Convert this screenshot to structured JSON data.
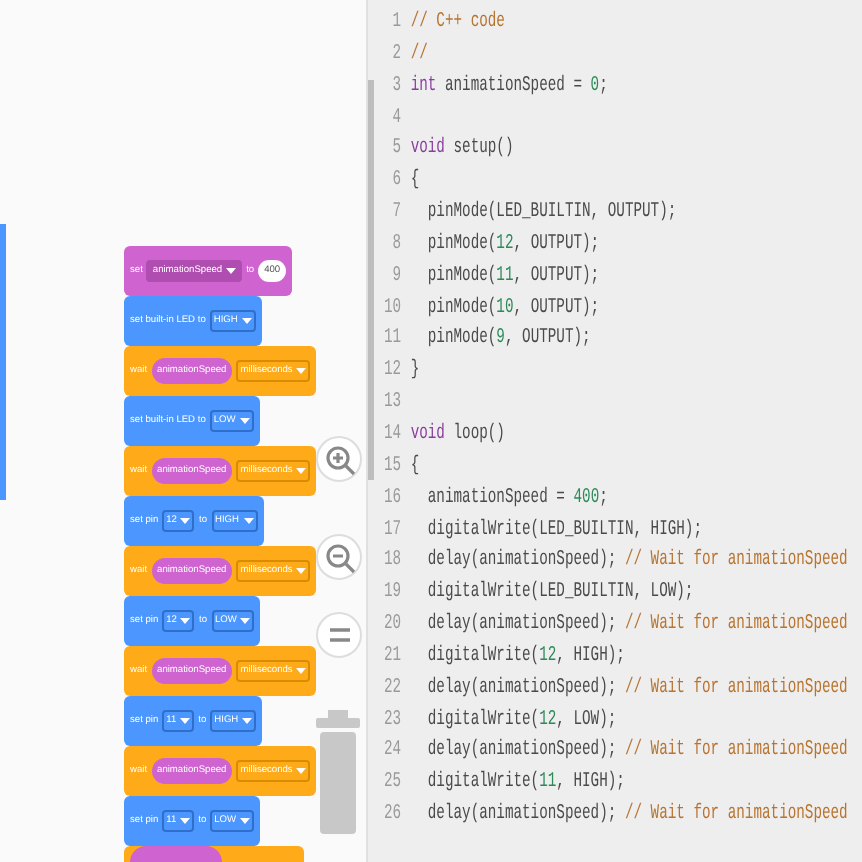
{
  "blocks_workspace": {
    "blocks": [
      {
        "kind": "set_variable",
        "label": "set",
        "variable": "animationSpeed",
        "to": "to",
        "value": "400"
      },
      {
        "kind": "set_led",
        "label": "set built-in LED to",
        "state": "HIGH"
      },
      {
        "kind": "wait",
        "label": "wait",
        "variable": "animationSpeed",
        "unit": "milliseconds"
      },
      {
        "kind": "set_led",
        "label": "set built-in LED to",
        "state": "LOW"
      },
      {
        "kind": "wait",
        "label": "wait",
        "variable": "animationSpeed",
        "unit": "milliseconds"
      },
      {
        "kind": "set_pin",
        "label": "set pin",
        "pin": "12",
        "to": "to",
        "state": "HIGH"
      },
      {
        "kind": "wait",
        "label": "wait",
        "variable": "animationSpeed",
        "unit": "milliseconds"
      },
      {
        "kind": "set_pin",
        "label": "set pin",
        "pin": "12",
        "to": "to",
        "state": "LOW"
      },
      {
        "kind": "wait",
        "label": "wait",
        "variable": "animationSpeed",
        "unit": "milliseconds"
      },
      {
        "kind": "set_pin",
        "label": "set pin",
        "pin": "11",
        "to": "to",
        "state": "HIGH"
      },
      {
        "kind": "wait",
        "label": "wait",
        "variable": "animationSpeed",
        "unit": "milliseconds"
      },
      {
        "kind": "set_pin",
        "label": "set pin",
        "pin": "11",
        "to": "to",
        "state": "LOW"
      },
      {
        "kind": "partial"
      }
    ]
  },
  "code_editor": {
    "lines": [
      {
        "number": "1",
        "tokens": [
          {
            "kind": "comment",
            "text": "// C++ code"
          }
        ]
      },
      {
        "number": "2",
        "tokens": [
          {
            "kind": "comment",
            "text": "//"
          }
        ]
      },
      {
        "number": "3",
        "tokens": [
          {
            "kind": "keyword",
            "text": "int"
          },
          {
            "kind": "plain",
            "text": " animationSpeed = "
          },
          {
            "kind": "number",
            "text": "0"
          },
          {
            "kind": "plain",
            "text": ";"
          }
        ]
      },
      {
        "number": "4"
      },
      {
        "number": "5",
        "tokens": [
          {
            "kind": "keyword",
            "text": "void"
          },
          {
            "kind": "plain",
            "text": " setup()"
          }
        ]
      },
      {
        "number": "6",
        "tokens": [
          {
            "kind": "plain",
            "text": "{"
          }
        ]
      },
      {
        "number": "7",
        "tokens": [
          {
            "kind": "plain",
            "text": "  pinMode(LED_BUILTIN, OUTPUT);"
          }
        ]
      },
      {
        "number": "8",
        "tokens": [
          {
            "kind": "plain",
            "text": "  pinMode("
          },
          {
            "kind": "number",
            "text": "12"
          },
          {
            "kind": "plain",
            "text": ", OUTPUT);"
          }
        ]
      },
      {
        "number": "9",
        "tokens": [
          {
            "kind": "plain",
            "text": "  pinMode("
          },
          {
            "kind": "number",
            "text": "11"
          },
          {
            "kind": "plain",
            "text": ", OUTPUT);"
          }
        ]
      },
      {
        "number": "10",
        "tokens": [
          {
            "kind": "plain",
            "text": "  pinMode("
          },
          {
            "kind": "number",
            "text": "10"
          },
          {
            "kind": "plain",
            "text": ", OUTPUT);"
          }
        ]
      },
      {
        "number": "11",
        "tokens": [
          {
            "kind": "plain",
            "text": "  pinMode("
          },
          {
            "kind": "number",
            "text": "9"
          },
          {
            "kind": "plain",
            "text": ", OUTPUT);"
          }
        ]
      },
      {
        "number": "12",
        "tokens": [
          {
            "kind": "plain",
            "text": "}"
          }
        ]
      },
      {
        "number": "13"
      },
      {
        "number": "14",
        "tokens": [
          {
            "kind": "keyword",
            "text": "void"
          },
          {
            "kind": "plain",
            "text": " loop()"
          }
        ]
      },
      {
        "number": "15",
        "tokens": [
          {
            "kind": "plain",
            "text": "{"
          }
        ]
      },
      {
        "number": "16",
        "tokens": [
          {
            "kind": "plain",
            "text": "  animationSpeed = "
          },
          {
            "kind": "number",
            "text": "400"
          },
          {
            "kind": "plain",
            "text": ";"
          }
        ]
      },
      {
        "number": "17",
        "tokens": [
          {
            "kind": "plain",
            "text": "  digitalWrite(LED_BUILTIN, HIGH);"
          }
        ]
      },
      {
        "number": "18",
        "tokens": [
          {
            "kind": "plain",
            "text": "  delay(animationSpeed); "
          },
          {
            "kind": "comment",
            "text": "// Wait for animationSpeed"
          }
        ]
      },
      {
        "number": "19",
        "tokens": [
          {
            "kind": "plain",
            "text": "  digitalWrite(LED_BUILTIN, LOW);"
          }
        ]
      },
      {
        "number": "20",
        "tokens": [
          {
            "kind": "plain",
            "text": "  delay(animationSpeed); "
          },
          {
            "kind": "comment",
            "text": "// Wait for animationSpeed"
          }
        ]
      },
      {
        "number": "21",
        "tokens": [
          {
            "kind": "plain",
            "text": "  digitalWrite("
          },
          {
            "kind": "number",
            "text": "12"
          },
          {
            "kind": "plain",
            "text": ", HIGH);"
          }
        ]
      },
      {
        "number": "22",
        "tokens": [
          {
            "kind": "plain",
            "text": "  delay(animationSpeed); "
          },
          {
            "kind": "comment",
            "text": "// Wait for animationSpeed"
          }
        ]
      },
      {
        "number": "23",
        "tokens": [
          {
            "kind": "plain",
            "text": "  digitalWrite("
          },
          {
            "kind": "number",
            "text": "12"
          },
          {
            "kind": "plain",
            "text": ", LOW);"
          }
        ]
      },
      {
        "number": "24",
        "tokens": [
          {
            "kind": "plain",
            "text": "  delay(animationSpeed); "
          },
          {
            "kind": "comment",
            "text": "// Wait for animationSpeed"
          }
        ]
      },
      {
        "number": "25",
        "tokens": [
          {
            "kind": "plain",
            "text": "  digitalWrite("
          },
          {
            "kind": "number",
            "text": "11"
          },
          {
            "kind": "plain",
            "text": ", HIGH);"
          }
        ]
      },
      {
        "number": "26",
        "tokens": [
          {
            "kind": "plain",
            "text": "  delay(animationSpeed); "
          },
          {
            "kind": "comment",
            "text": "// Wait for animationSpeed"
          }
        ]
      }
    ]
  }
}
